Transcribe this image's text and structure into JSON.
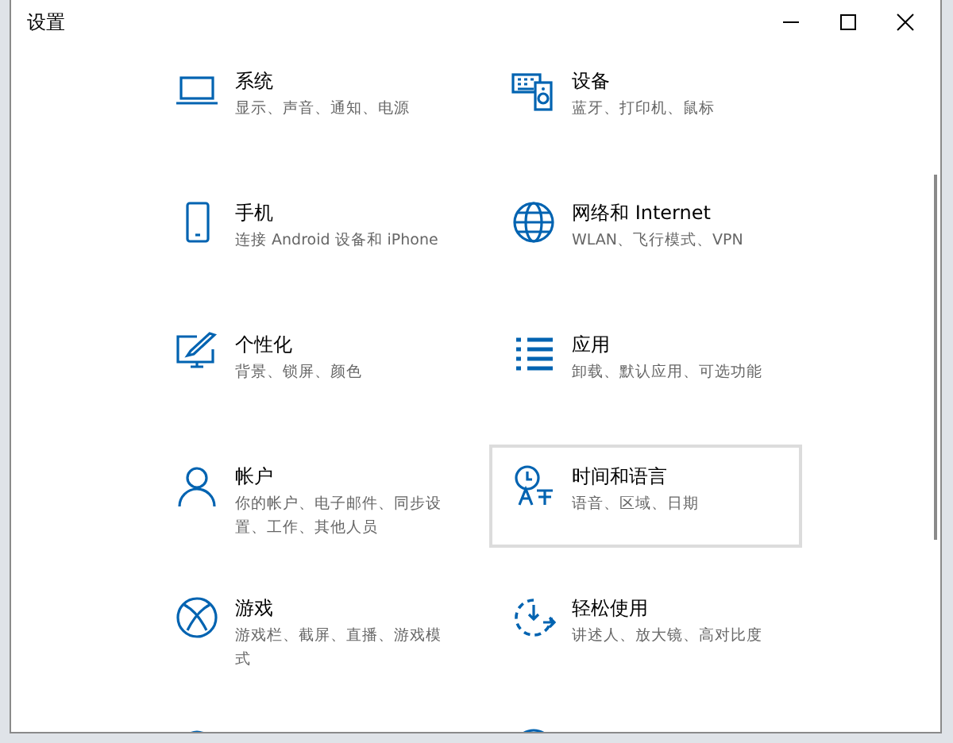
{
  "window": {
    "title": "设置",
    "controls": [
      {
        "kind": "minimize"
      },
      {
        "kind": "maximize"
      },
      {
        "kind": "close"
      }
    ]
  },
  "tiles": [
    {
      "kind": "laptop",
      "title": "系统",
      "subtitle": "显示、声音、通知、电源",
      "hovered": false
    },
    {
      "kind": "devices",
      "title": "设备",
      "subtitle": "蓝牙、打印机、鼠标",
      "hovered": false
    },
    {
      "kind": "phone",
      "title": "手机",
      "subtitle": "连接 Android 设备和 iPhone",
      "hovered": false
    },
    {
      "kind": "globe",
      "title": "网络和 Internet",
      "subtitle": "WLAN、飞行模式、VPN",
      "hovered": false
    },
    {
      "kind": "brush",
      "title": "个性化",
      "subtitle": "背景、锁屏、颜色",
      "hovered": false
    },
    {
      "kind": "apps",
      "title": "应用",
      "subtitle": "卸载、默认应用、可选功能",
      "hovered": false
    },
    {
      "kind": "person",
      "title": "帐户",
      "subtitle": "你的帐户、电子邮件、同步设置、工作、其他人员",
      "hovered": false
    },
    {
      "kind": "clock",
      "title": "时间和语言",
      "subtitle": "语音、区域、日期",
      "hovered": true
    },
    {
      "kind": "xbox",
      "title": "游戏",
      "subtitle": "游戏栏、截屏、直播、游戏模式",
      "hovered": false
    },
    {
      "kind": "ease",
      "title": "轻松使用",
      "subtitle": "讲述人、放大镜、高对比度",
      "hovered": false
    },
    {
      "kind": "search"
    },
    {
      "kind": "ring"
    }
  ]
}
